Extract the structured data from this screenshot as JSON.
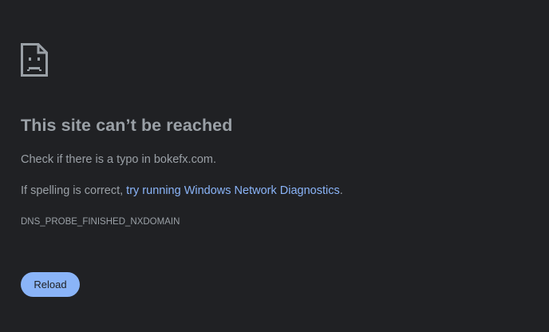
{
  "error": {
    "icon": "sad-page-icon",
    "title": "This site can’t be reached",
    "typo_hint_prefix": "Check if there is a typo in ",
    "domain": "bokefx.com",
    "typo_hint_suffix": ".",
    "spelling_prefix": "If spelling is correct, ",
    "diagnostics_link": "try running Windows Network Diagnostics",
    "spelling_suffix": ".",
    "error_code": "DNS_PROBE_FINISHED_NXDOMAIN",
    "reload_label": "Reload"
  },
  "colors": {
    "background": "#202124",
    "text": "#9aa0a6",
    "link": "#8ab4f8",
    "button": "#8ab4f8",
    "button_text": "#202124"
  }
}
